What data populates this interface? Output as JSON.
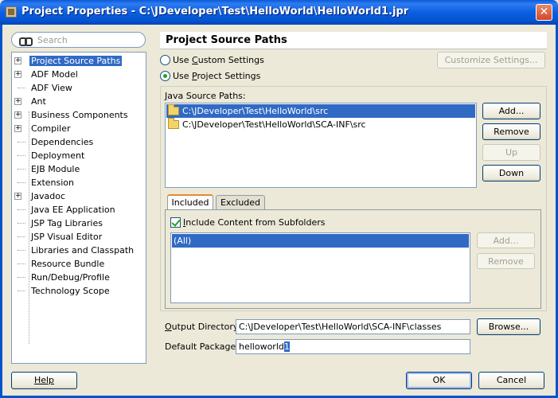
{
  "window": {
    "title": "Project Properties - C:\\JDeveloper\\Test\\HelloWorld\\HelloWorld1.jpr",
    "close_glyph": "✕"
  },
  "search": {
    "placeholder": "Search"
  },
  "tree": {
    "items": [
      {
        "label": "Project Source Paths",
        "expandable": true,
        "selected": true
      },
      {
        "label": "ADF Model",
        "expandable": true
      },
      {
        "label": "ADF View",
        "expandable": false
      },
      {
        "label": "Ant",
        "expandable": true
      },
      {
        "label": "Business Components",
        "expandable": true
      },
      {
        "label": "Compiler",
        "expandable": true
      },
      {
        "label": "Dependencies",
        "expandable": false
      },
      {
        "label": "Deployment",
        "expandable": false
      },
      {
        "label": "EJB Module",
        "expandable": false
      },
      {
        "label": "Extension",
        "expandable": false
      },
      {
        "label": "Javadoc",
        "expandable": true
      },
      {
        "label": "Java EE Application",
        "expandable": false
      },
      {
        "label": "JSP Tag Libraries",
        "expandable": false
      },
      {
        "label": "JSP Visual Editor",
        "expandable": false
      },
      {
        "label": "Libraries and Classpath",
        "expandable": false
      },
      {
        "label": "Resource Bundle",
        "expandable": false
      },
      {
        "label": "Run/Debug/Profile",
        "expandable": false
      },
      {
        "label": "Technology Scope",
        "expandable": false
      }
    ]
  },
  "panel": {
    "title": "Project Source Paths",
    "use_custom_pre": "Use ",
    "use_custom_key": "C",
    "use_custom_post": "ustom Settings",
    "use_project_pre": "Use ",
    "use_project_key": "P",
    "use_project_post": "roject Settings",
    "selected_setting": "project",
    "customize_button": "Customize Settings...",
    "java_source_label_key": "J",
    "java_source_label_post": "ava Source Paths:",
    "source_paths": [
      {
        "path": "C:\\JDeveloper\\Test\\HelloWorld\\src",
        "selected": true
      },
      {
        "path": "C:\\JDeveloper\\Test\\HelloWorld\\SCA-INF\\src",
        "selected": false
      }
    ],
    "add_button": "Add...",
    "remove_button": "Remove",
    "up_button": "Up",
    "down_button": "Down",
    "tabs": {
      "included": "Included",
      "excluded": "Excluded",
      "active": "included"
    },
    "include_subfolders_key": "I",
    "include_subfolders_post": "nclude Content from Subfolders",
    "include_subfolders_checked": true,
    "include_list": [
      "(All)"
    ],
    "tab_add_button": "Add...",
    "tab_remove_button": "Remove",
    "output_dir_label_key": "O",
    "output_dir_label_post": "utput Directory:",
    "output_dir_value": "C:\\JDeveloper\\Test\\HelloWorld\\SCA-INF\\classes",
    "browse_button": "Browse...",
    "default_package_label": "Default Package:",
    "default_package_value": "helloworld",
    "default_package_selected_suffix": "1"
  },
  "footer": {
    "help_button": "Help",
    "ok_button": "OK",
    "cancel_button": "Cancel"
  },
  "colors": {
    "titlebar": "#0553cf",
    "selection": "#316ac5",
    "dialog_bg": "#ece9d8"
  }
}
